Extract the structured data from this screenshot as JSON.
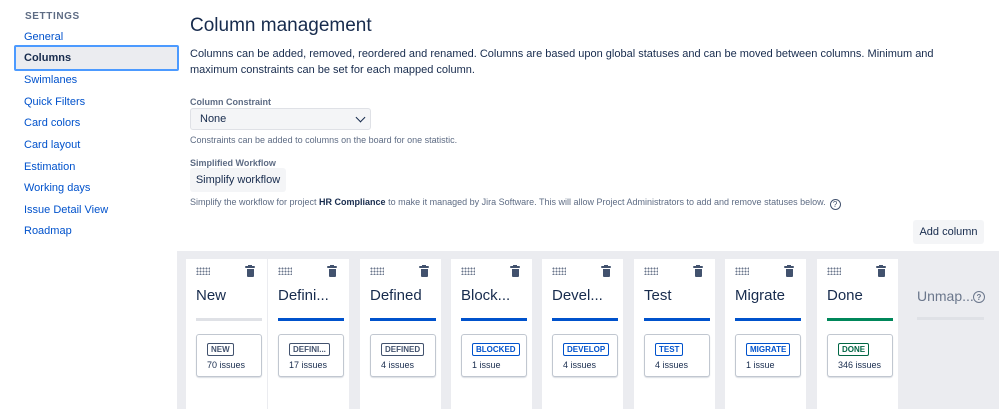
{
  "sidebar": {
    "heading": "SETTINGS",
    "items": [
      {
        "label": "General"
      },
      {
        "label": "Columns",
        "active": true
      },
      {
        "label": "Swimlanes"
      },
      {
        "label": "Quick Filters"
      },
      {
        "label": "Card colors"
      },
      {
        "label": "Card layout"
      },
      {
        "label": "Estimation"
      },
      {
        "label": "Working days"
      },
      {
        "label": "Issue Detail View"
      },
      {
        "label": "Roadmap"
      }
    ]
  },
  "main": {
    "title": "Column management",
    "description": "Columns can be added, removed, reordered and renamed. Columns are based upon global statuses and can be moved between columns. Minimum and maximum constraints can be set for each mapped column.",
    "constraint": {
      "label": "Column Constraint",
      "value": "None",
      "help": "Constraints can be added to columns on the board for one statistic."
    },
    "workflow": {
      "label": "Simplified Workflow",
      "button": "Simplify workflow",
      "help_prefix": "Simplify the workflow for project ",
      "project": "HR Compliance",
      "help_suffix": " to make it managed by Jira Software. This will allow Project Administrators to add and remove statuses below.",
      "help_icon": "?"
    },
    "add_column_label": "Add column"
  },
  "colors": {
    "blue_bar": "#0052cc",
    "green_bar": "#00875a",
    "grey_bar": "#dfe1e6",
    "blue_lozenge": "#0052cc",
    "green_lozenge": "#006644",
    "grey_lozenge": "#42526e"
  },
  "columns": [
    {
      "name": "New",
      "bar": "grey",
      "status": "NEW",
      "lozenge": "grey",
      "count": "70 issues"
    },
    {
      "name": "Defini...",
      "bar": "blue",
      "status": "DEFINI...",
      "lozenge": "grey",
      "count": "17 issues"
    },
    {
      "name": "Defined",
      "bar": "blue",
      "status": "DEFINED",
      "lozenge": "grey",
      "count": "4 issues"
    },
    {
      "name": "Block...",
      "bar": "blue",
      "status": "BLOCKED",
      "lozenge": "blue",
      "count": "1 issue"
    },
    {
      "name": "Devel...",
      "bar": "blue",
      "status": "DEVELOP",
      "lozenge": "blue",
      "count": "4 issues"
    },
    {
      "name": "Test",
      "bar": "blue",
      "status": "TEST",
      "lozenge": "blue",
      "count": "4 issues"
    },
    {
      "name": "Migrate",
      "bar": "blue",
      "status": "MIGRATE",
      "lozenge": "blue",
      "count": "1 issue"
    },
    {
      "name": "Done",
      "bar": "green",
      "status": "DONE",
      "lozenge": "green",
      "count": "346 issues"
    }
  ],
  "unmapped": {
    "label": "Unmap...",
    "help_icon": "?"
  }
}
